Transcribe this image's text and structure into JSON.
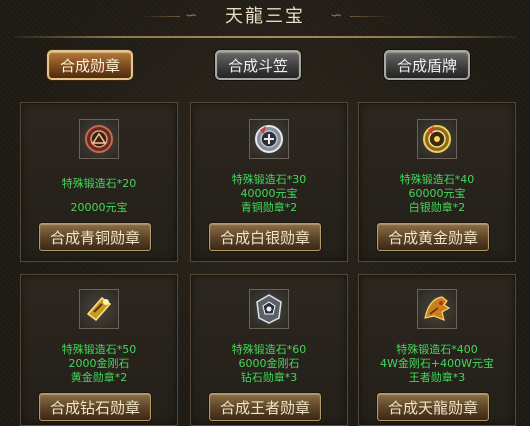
{
  "title": "天龍三宝",
  "tabs": [
    {
      "label": "合成勋章",
      "active": true
    },
    {
      "label": "合成斗笠",
      "active": false
    },
    {
      "label": "合成盾牌",
      "active": false
    }
  ],
  "cards": [
    {
      "icon": "medal-icon",
      "lines": [
        "特殊锻造石*20",
        "",
        "20000元宝"
      ],
      "button": "合成青铜勋章"
    },
    {
      "icon": "medal-icon",
      "lines": [
        "特殊锻造石*30",
        "40000元宝",
        "青铜勋章*2"
      ],
      "button": "合成白银勋章"
    },
    {
      "icon": "medal-icon",
      "lines": [
        "特殊锻造石*40",
        "60000元宝",
        "白银勋章*2"
      ],
      "button": "合成黄金勋章"
    },
    {
      "icon": "medal-icon",
      "lines": [
        "特殊锻造石*50",
        "2000金刚石",
        "黄金勋章*2"
      ],
      "button": "合成钻石勋章"
    },
    {
      "icon": "medal-icon",
      "lines": [
        "特殊锻造石*60",
        "6000金刚石",
        "钻石勋章*3"
      ],
      "button": "合成王者勋章"
    },
    {
      "icon": "medal-icon",
      "lines": [
        "特殊锻造石*400",
        "4W金刚石+400W元宝",
        "王者勋章*3"
      ],
      "button": "合成天龍勋章"
    }
  ]
}
